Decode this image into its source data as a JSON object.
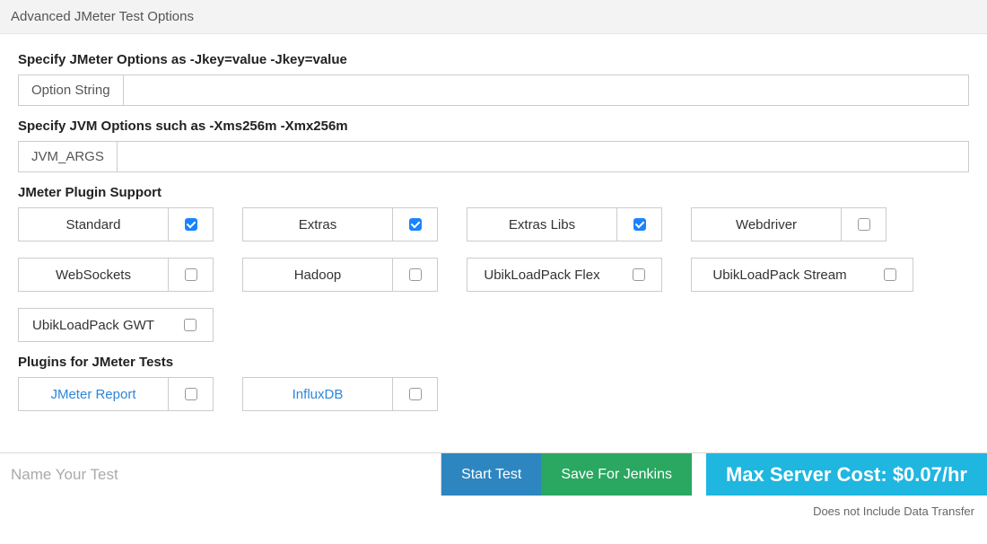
{
  "header": {
    "title": "Advanced JMeter Test Options"
  },
  "options": {
    "jmeter": {
      "label": "Specify JMeter Options as -Jkey=value -Jkey=value",
      "addon": "Option String",
      "value": ""
    },
    "jvm": {
      "label": "Specify JVM Options such as -Xms256m -Xmx256m",
      "addon": "JVM_ARGS",
      "value": ""
    }
  },
  "pluginSupport": {
    "label": "JMeter Plugin Support",
    "items": [
      {
        "name": "Standard",
        "checked": true
      },
      {
        "name": "Extras",
        "checked": true
      },
      {
        "name": "Extras Libs",
        "checked": true
      },
      {
        "name": "Webdriver",
        "checked": false
      },
      {
        "name": "WebSockets",
        "checked": false
      },
      {
        "name": "Hadoop",
        "checked": false
      },
      {
        "name": "UbikLoadPack Flex",
        "checked": false
      },
      {
        "name": "UbikLoadPack Stream",
        "checked": false
      },
      {
        "name": "UbikLoadPack GWT",
        "checked": false
      }
    ]
  },
  "pluginsForTests": {
    "label": "Plugins for JMeter Tests",
    "items": [
      {
        "name": "JMeter Report",
        "checked": false
      },
      {
        "name": "InfluxDB",
        "checked": false
      }
    ]
  },
  "bottomBar": {
    "namePlaceholder": "Name Your Test",
    "startTest": "Start Test",
    "saveForJenkins": "Save For Jenkins",
    "cost": "Max Server Cost: $0.07/hr",
    "disclaimer": "Does not Include Data Transfer"
  }
}
